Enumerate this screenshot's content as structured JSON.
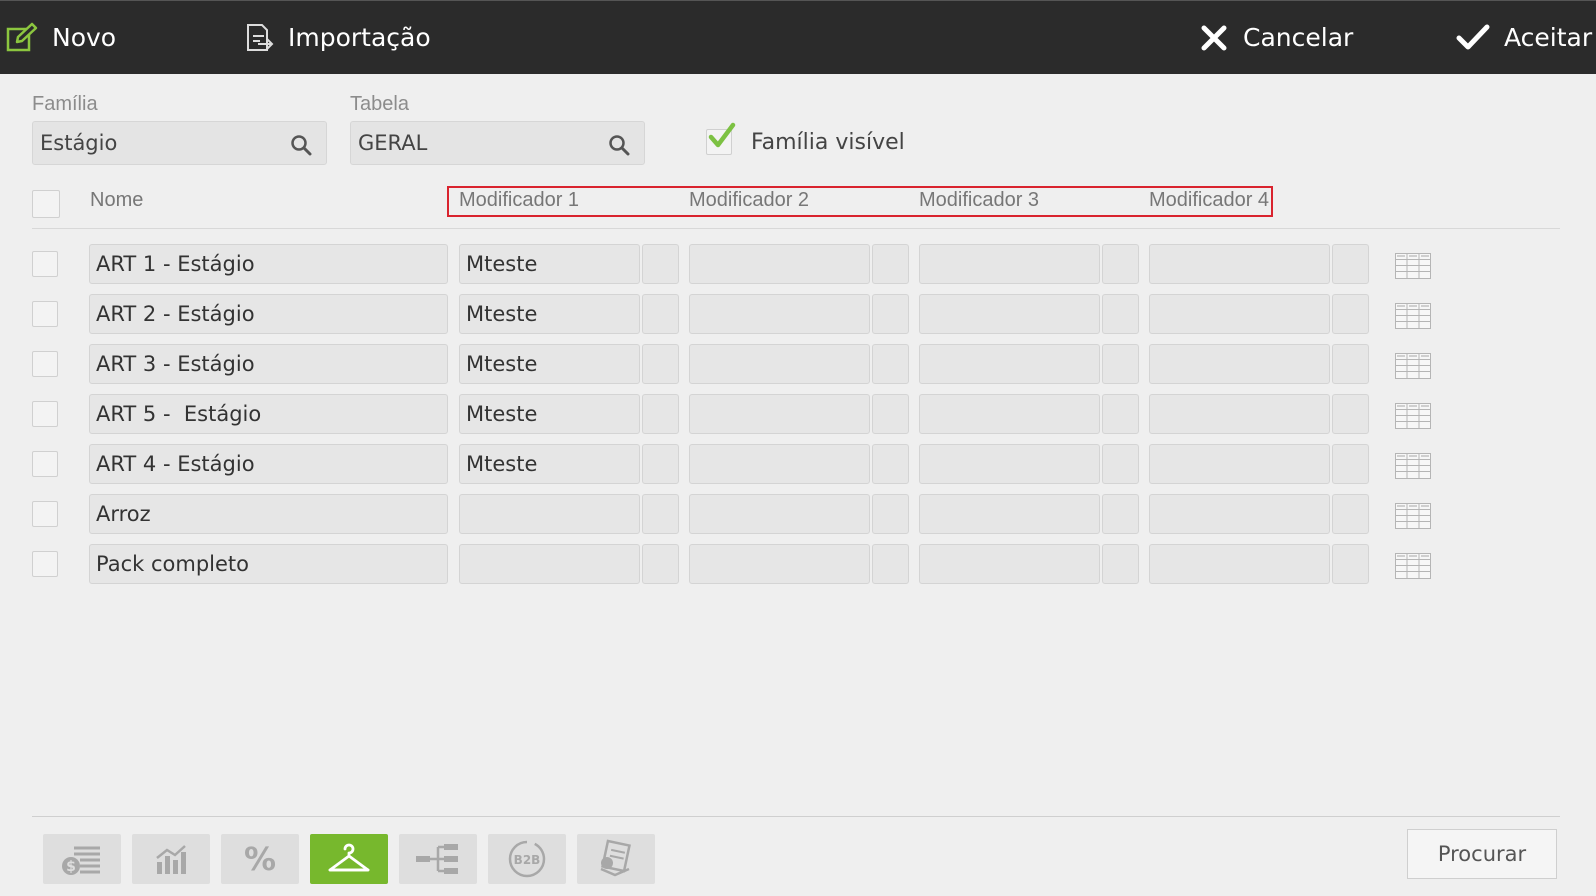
{
  "toolbar": {
    "novo": "Novo",
    "importacao": "Importação",
    "cancelar": "Cancelar",
    "aceitar": "Aceitar"
  },
  "filters": {
    "familia_label": "Família",
    "familia_value": "Estágio",
    "tabela_label": "Tabela",
    "tabela_value": "GERAL",
    "visible_label": "Família visível",
    "visible_checked": true
  },
  "table": {
    "headers": {
      "nome": "Nome",
      "mod1": "Modificador 1",
      "mod2": "Modificador 2",
      "mod3": "Modificador 3",
      "mod4": "Modificador 4"
    },
    "rows": [
      {
        "nome": "ART 1 - Estágio",
        "mod1": "Mteste",
        "mod2": "",
        "mod3": "",
        "mod4": ""
      },
      {
        "nome": "ART 2 - Estágio",
        "mod1": "Mteste",
        "mod2": "",
        "mod3": "",
        "mod4": ""
      },
      {
        "nome": "ART 3 - Estágio",
        "mod1": "Mteste",
        "mod2": "",
        "mod3": "",
        "mod4": ""
      },
      {
        "nome": "ART 5 -  Estágio",
        "mod1": "Mteste",
        "mod2": "",
        "mod3": "",
        "mod4": ""
      },
      {
        "nome": "ART 4 - Estágio",
        "mod1": "Mteste",
        "mod2": "",
        "mod3": "",
        "mod4": ""
      },
      {
        "nome": "Arroz",
        "mod1": "",
        "mod2": "",
        "mod3": "",
        "mod4": ""
      },
      {
        "nome": "Pack completo",
        "mod1": "",
        "mod2": "",
        "mod3": "",
        "mod4": ""
      }
    ]
  },
  "bottom": {
    "procurar": "Procurar",
    "tools": [
      "price-list-icon",
      "chart-icon",
      "percent-icon",
      "hanger-icon",
      "hierarchy-icon",
      "b2b-icon",
      "pricing-docs-icon"
    ],
    "active_tool": "hanger-icon",
    "percent_glyph": "%",
    "b2b_text": "B2B"
  },
  "colors": {
    "topbar": "#2b2b2b",
    "accent_green": "#77b82d",
    "highlight_red": "#d9232e"
  }
}
